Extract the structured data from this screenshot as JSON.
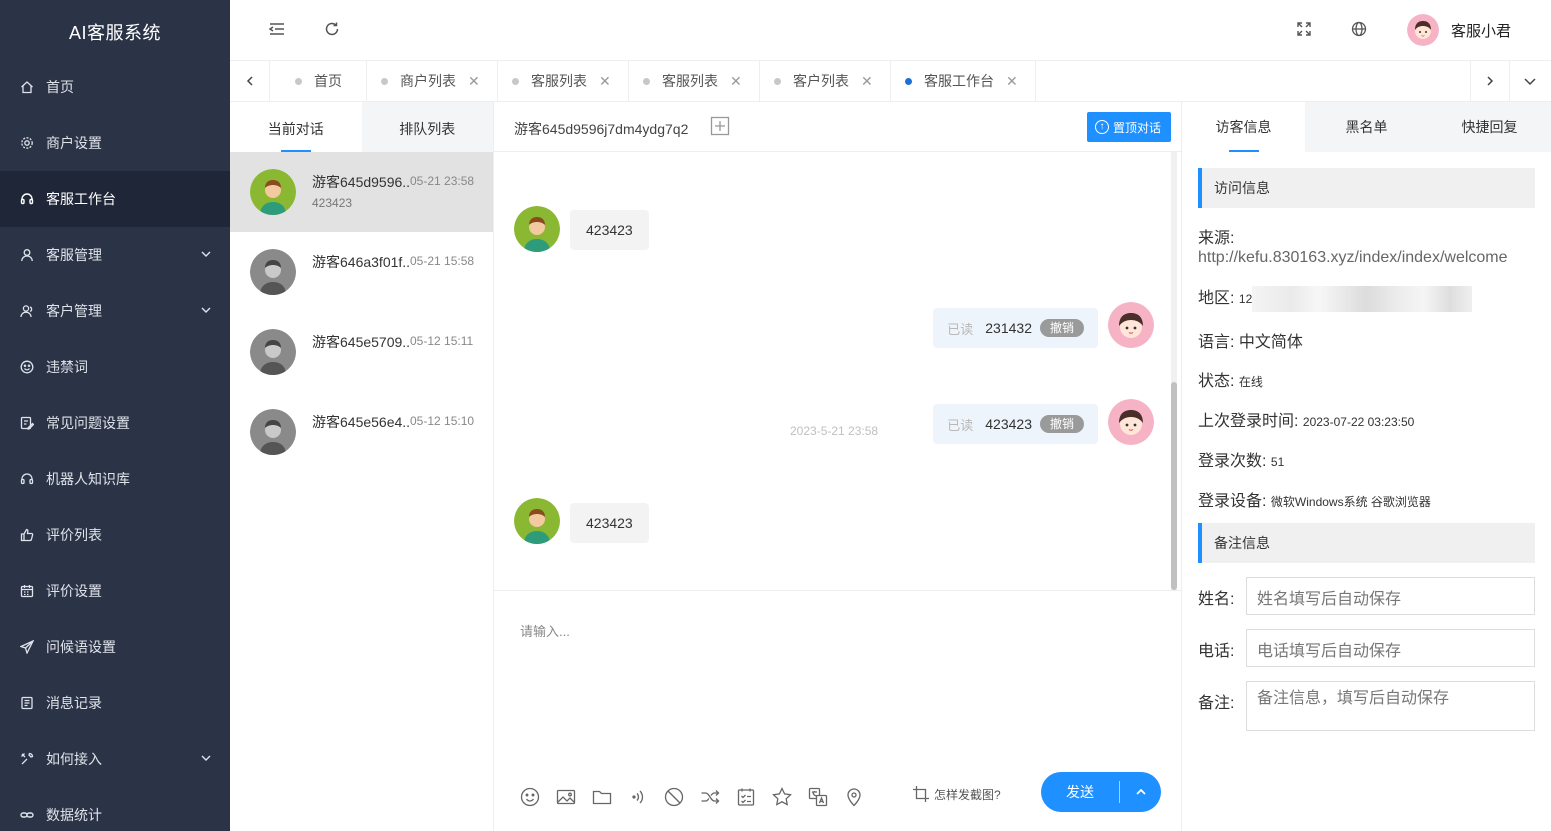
{
  "app_title": "AI客服系统",
  "sidebar": {
    "items": [
      {
        "label": "首页",
        "icon": "home-icon"
      },
      {
        "label": "商户设置",
        "icon": "gear-icon"
      },
      {
        "label": "客服工作台",
        "icon": "headset-icon",
        "active": true
      },
      {
        "label": "客服管理",
        "icon": "user-icon",
        "has_children": true
      },
      {
        "label": "客户管理",
        "icon": "users-icon",
        "has_children": true
      },
      {
        "label": "违禁词",
        "icon": "smile-icon"
      },
      {
        "label": "常见问题设置",
        "icon": "edit-doc-icon"
      },
      {
        "label": "机器人知识库",
        "icon": "robot-icon"
      },
      {
        "label": "评价列表",
        "icon": "thumb-up-icon"
      },
      {
        "label": "评价设置",
        "icon": "calendar-icon"
      },
      {
        "label": "问候语设置",
        "icon": "send-icon"
      },
      {
        "label": "消息记录",
        "icon": "record-icon"
      },
      {
        "label": "如何接入",
        "icon": "tools-icon",
        "has_children": true
      },
      {
        "label": "数据统计",
        "icon": "link-icon"
      }
    ]
  },
  "header": {
    "user_name": "客服小君"
  },
  "tabs": [
    {
      "label": "首页",
      "closable": false
    },
    {
      "label": "商户列表",
      "closable": true
    },
    {
      "label": "客服列表",
      "closable": true
    },
    {
      "label": "客服列表",
      "closable": true
    },
    {
      "label": "客户列表",
      "closable": true
    },
    {
      "label": "客服工作台",
      "closable": true,
      "active": true
    }
  ],
  "conversations": {
    "tabs": [
      "当前对话",
      "排队列表"
    ],
    "items": [
      {
        "name": "游客645d9596..",
        "time": "05-21 23:58",
        "last_msg": "423423",
        "online": true,
        "active": true
      },
      {
        "name": "游客646a3f01f..",
        "time": "05-21 15:58",
        "last_msg": "",
        "online": false
      },
      {
        "name": "游客645e5709..",
        "time": "05-12 15:11",
        "last_msg": "",
        "online": false
      },
      {
        "name": "游客645e56e4..",
        "time": "05-12 15:10",
        "last_msg": "",
        "online": false
      }
    ]
  },
  "chat": {
    "title": "游客645d9596j7dm4ydg7q2",
    "top_button": "置顶对话",
    "messages": [
      {
        "side": "left",
        "text": "423423"
      },
      {
        "side": "right",
        "text": "231432",
        "read_label": "已读",
        "recall_label": "撤销"
      },
      {
        "side": "time",
        "text": "2023-5-21 23:58"
      },
      {
        "side": "right",
        "text": "423423",
        "read_label": "已读",
        "recall_label": "撤销"
      },
      {
        "side": "left",
        "text": "423423"
      }
    ],
    "input_placeholder": "请输入...",
    "screenshot_tip": "怎样发截图?",
    "send_label": "发送"
  },
  "right_panel": {
    "tabs": [
      "访客信息",
      "黑名单",
      "快捷回复"
    ],
    "visit_section": "访问信息",
    "source_label": "来源:",
    "source_url": "http://kefu.830163.xyz/index/index/welcome",
    "region_label": "地区:",
    "region_value": "12",
    "language_label": "语言:",
    "language_value": "中文简体",
    "status_label": "状态:",
    "status_value": "在线",
    "last_login_label": "上次登录时间:",
    "last_login_value": "2023-07-22 03:23:50",
    "login_count_label": "登录次数:",
    "login_count_value": "51",
    "device_label": "登录设备:",
    "device_value": "微软Windows系统 谷歌浏览器",
    "notes_section": "备注信息",
    "name_label": "姓名:",
    "name_placeholder": "姓名填写后自动保存",
    "phone_label": "电话:",
    "phone_placeholder": "电话填写后自动保存",
    "remark_label": "备注:",
    "remark_placeholder": "备注信息，填写后自动保存"
  },
  "colors": {
    "sidebar_bg": "#2b3447",
    "sidebar_active": "#1f2637",
    "accent": "#1e90ff",
    "active_tab_dot": "#1e6fd9"
  }
}
